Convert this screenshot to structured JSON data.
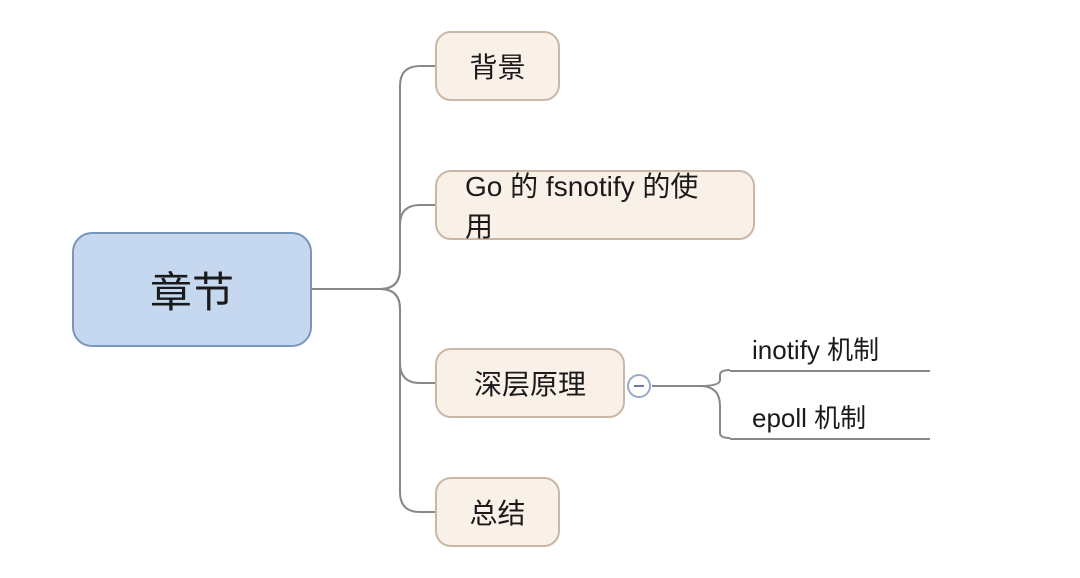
{
  "root": {
    "label": "章节"
  },
  "children": [
    {
      "label": "背景"
    },
    {
      "label": "Go 的 fsnotify 的使用"
    },
    {
      "label": "深层原理"
    },
    {
      "label": "总结"
    }
  ],
  "subchildren": [
    {
      "label": "inotify 机制"
    },
    {
      "label": "epoll 机制"
    }
  ],
  "colors": {
    "rootBg": "#c5d8f0",
    "rootBorder": "#7a96b8",
    "childBg": "#f9f0e8",
    "childBorder": "#c9b8a8",
    "connector": "#888888"
  }
}
